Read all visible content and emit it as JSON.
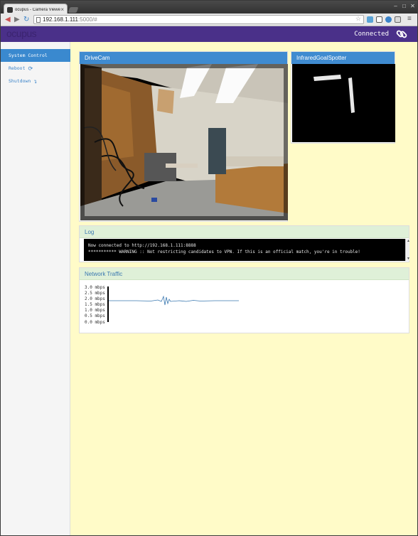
{
  "browser": {
    "tab_title": "ocupus - Camera Viewer",
    "url_host": "192.168.1.111",
    "url_rest": ":5000/#"
  },
  "app": {
    "logo": "ocupus",
    "status": "Connected",
    "colors": {
      "header": "#4a3089",
      "accent": "#3a89cf",
      "background": "#fffbc8"
    }
  },
  "sidebar": {
    "items": [
      {
        "label": "System Control",
        "icon": ""
      },
      {
        "label": "Reboot",
        "icon": "refresh-icon"
      },
      {
        "label": "Shutdown",
        "icon": "power-arrow-icon"
      }
    ]
  },
  "cameras": [
    {
      "title": "DriveCam"
    },
    {
      "title": "InfraredGoalSpotter"
    }
  ],
  "log": {
    "title": "Log",
    "lines": [
      "Now connected to http://192.168.1.111:8888",
      "*********** WARNING :: Not restricting candidates to VPN. If this is an official match, you're in trouble!"
    ]
  },
  "network": {
    "title": "Network Traffic",
    "axis_labels": [
      "3.0 mbps",
      "2.5 mbps",
      "2.0 mbps",
      "1.5 mbps",
      "1.0 mbps",
      "0.5 mbps",
      "0.0 mbps"
    ]
  }
}
